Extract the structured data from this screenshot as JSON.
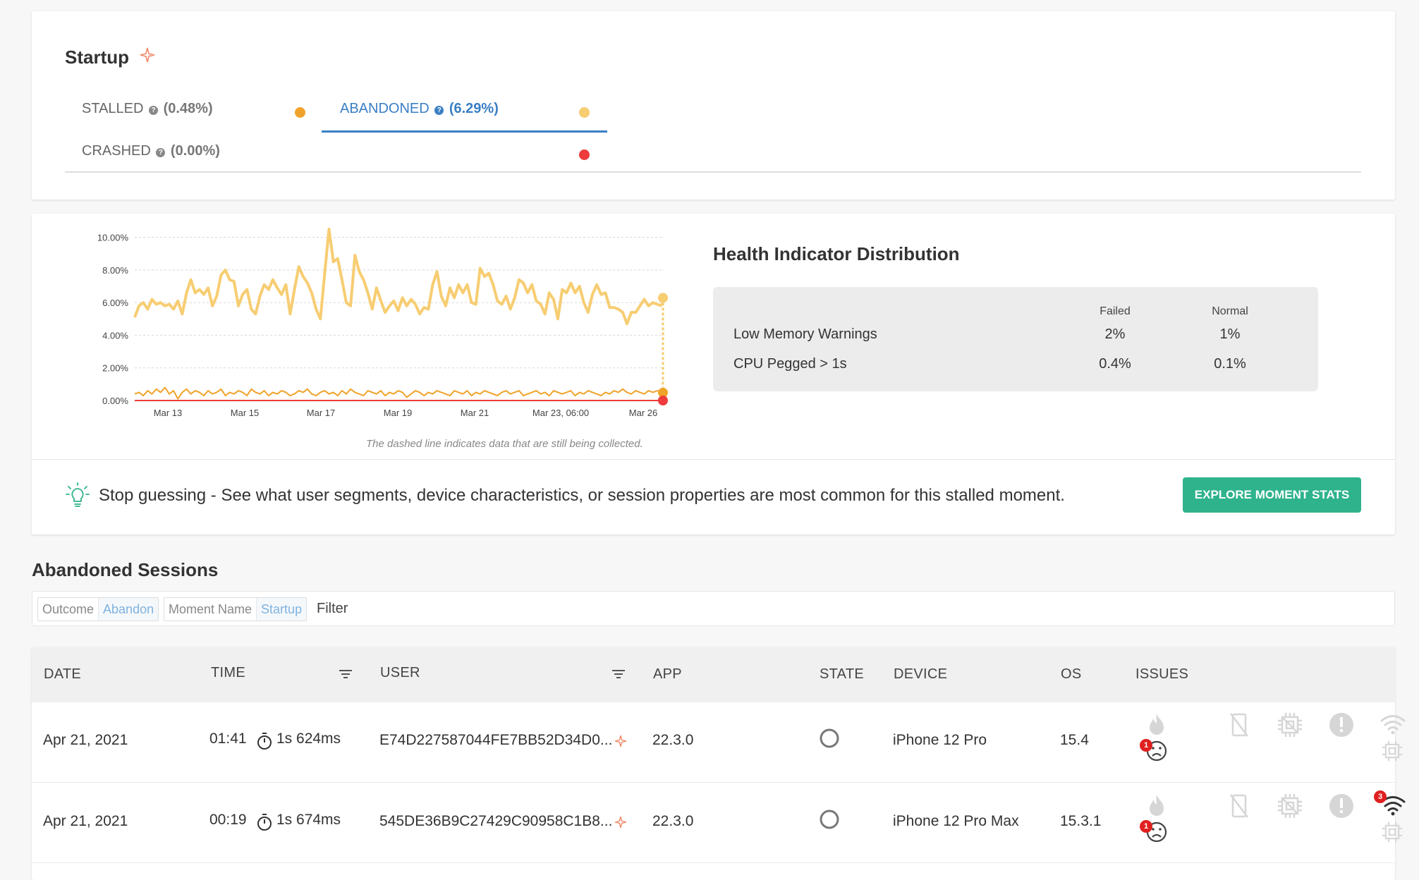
{
  "startup": {
    "title": "Startup",
    "tabs": [
      {
        "label": "STALLED",
        "pct": "(0.48%)",
        "color": "#f0a32a"
      },
      {
        "label": "ABANDONED",
        "pct": "(6.29%)",
        "color": "#f7cd72"
      },
      {
        "label": "CRASHED",
        "pct": "(0.00%)",
        "color": "#ee3b3b"
      }
    ],
    "active_tab": "ABANDONED"
  },
  "chart_data": {
    "type": "line",
    "y_ticks": [
      "10.00%",
      "8.00%",
      "6.00%",
      "4.00%",
      "2.00%",
      "0.00%"
    ],
    "ylim": [
      0,
      10.5
    ],
    "x_ticks": [
      "Mar 13",
      "Mar 15",
      "Mar 17",
      "Mar 19",
      "Mar 21",
      "Mar 23, 06:00",
      "Mar 26"
    ],
    "grid": true,
    "series": [
      {
        "color": "#f7cd72",
        "values": [
          5.1,
          5.8,
          6.0,
          5.6,
          6.2,
          5.9,
          6.0,
          5.8,
          5.9,
          5.6,
          6.1,
          5.3,
          6.6,
          7.4,
          6.6,
          6.8,
          6.5,
          6.9,
          5.8,
          6.4,
          7.7,
          8.0,
          7.4,
          7.3,
          5.8,
          6.5,
          6.8,
          5.6,
          5.3,
          6.4,
          7.1,
          6.8,
          7.4,
          6.9,
          6.5,
          7.1,
          5.3,
          6.8,
          8.2,
          7.6,
          7.2,
          6.6,
          5.6,
          5.0,
          7.8,
          10.5,
          8.5,
          8.7,
          7.4,
          6.0,
          5.8,
          8.9,
          7.9,
          7.4,
          6.6,
          5.6,
          6.9,
          6.1,
          5.4,
          5.8,
          6.1,
          5.5,
          6.3,
          5.8,
          6.2,
          5.9,
          5.3,
          5.7,
          5.6,
          7.1,
          7.9,
          6.4,
          5.8,
          6.9,
          6.3,
          7.1,
          6.6,
          7.1,
          6.0,
          5.9,
          8.1,
          7.6,
          7.8,
          7.1,
          6.1,
          5.9,
          6.4,
          5.6,
          6.3,
          7.4,
          7.2,
          6.6,
          7.1,
          6.1,
          5.9,
          5.3,
          6.6,
          6.2,
          5.0,
          6.8,
          6.6,
          7.2,
          6.6,
          7.0,
          6.0,
          5.4,
          6.5,
          7.1,
          6.5,
          6.6,
          5.7,
          5.7,
          5.6,
          5.4,
          4.7,
          5.4,
          5.4,
          5.8,
          6.2,
          5.8,
          6.0,
          5.9,
          5.8
        ]
      },
      {
        "color": "#f0a32a",
        "values": [
          0.4,
          0.5,
          0.3,
          0.6,
          0.4,
          0.7,
          0.5,
          0.8,
          0.4,
          0.6,
          0.1,
          0.5,
          0.7,
          0.4,
          0.6,
          0.5,
          0.3,
          0.6,
          0.4,
          0.5,
          0.7,
          0.3,
          0.5,
          0.4,
          0.6,
          0.5,
          0.3,
          0.7,
          0.5,
          0.4,
          0.6,
          0.3,
          0.5,
          0.4,
          0.6,
          0.5,
          0.3,
          0.4,
          0.6,
          0.5,
          0.7,
          0.4,
          0.3,
          0.5,
          0.6,
          0.4,
          0.5,
          0.3,
          0.6,
          0.4,
          0.7,
          0.5,
          0.4,
          0.3,
          0.6,
          0.5,
          0.4,
          0.6,
          0.3,
          0.5,
          0.4,
          0.6,
          0.5,
          0.2,
          0.4,
          0.6,
          0.5,
          0.3,
          0.5,
          0.4,
          0.6,
          0.5,
          0.4,
          0.3,
          0.6,
          0.5,
          0.4,
          0.6,
          0.3,
          0.5,
          0.4,
          0.6,
          0.5,
          0.4,
          0.3,
          0.5,
          0.6,
          0.4,
          0.5,
          0.6,
          0.3,
          0.4,
          0.5,
          0.6,
          0.4,
          0.5,
          0.3,
          0.6,
          0.5,
          0.4,
          0.5,
          0.6,
          0.3,
          0.5,
          0.4,
          0.6,
          0.5,
          0.4,
          0.3,
          0.5,
          0.4,
          0.6,
          0.5,
          0.7,
          0.5,
          0.4,
          0.6,
          0.5,
          0.4,
          0.6,
          0.5,
          0.6,
          0.5
        ]
      },
      {
        "color": "#ee3b3b",
        "values": [
          0.0,
          0.0,
          0.0,
          0.0,
          0.0,
          0.0,
          0.0,
          0.0,
          0.0,
          0.0,
          0.0,
          0.0,
          0.0,
          0.0,
          0.0,
          0.0,
          0.0,
          0.0,
          0.0,
          0.0,
          0.0,
          0.0,
          0.0,
          0.0,
          0.0,
          0.0,
          0.0,
          0.0,
          0.0,
          0.0,
          0.0,
          0.0,
          0.0,
          0.0,
          0.0,
          0.0,
          0.0,
          0.0,
          0.0,
          0.0,
          0.0,
          0.0,
          0.0,
          0.0,
          0.0,
          0.0,
          0.0,
          0.0,
          0.0,
          0.0,
          0.0,
          0.0,
          0.0,
          0.0,
          0.0,
          0.0,
          0.0,
          0.0,
          0.0,
          0.0,
          0.0,
          0.0,
          0.0,
          0.0,
          0.0,
          0.0,
          0.0,
          0.0,
          0.0,
          0.0,
          0.0,
          0.0,
          0.0,
          0.0,
          0.0,
          0.0,
          0.0,
          0.0,
          0.0,
          0.0,
          0.0,
          0.0,
          0.0,
          0.0,
          0.0,
          0.0,
          0.0,
          0.0,
          0.0,
          0.0,
          0.0,
          0.0,
          0.0,
          0.0,
          0.0,
          0.0,
          0.0,
          0.0,
          0.0,
          0.0,
          0.0,
          0.0,
          0.0,
          0.0,
          0.0,
          0.0,
          0.0,
          0.0,
          0.0,
          0.0,
          0.0,
          0.0,
          0.0,
          0.0,
          0.0,
          0.0,
          0.0,
          0.0,
          0.0,
          0.0,
          0.0,
          0.0,
          0.0
        ]
      }
    ],
    "end_values": [
      6.29,
      0.48,
      0.0
    ],
    "dashed_note": "The dashed line indicates data that are still being collected."
  },
  "health": {
    "title": "Health Indicator Distribution",
    "col_failed": "Failed",
    "col_normal": "Normal",
    "rows": [
      {
        "label": "Low Memory Warnings",
        "failed": "2%",
        "normal": "1%"
      },
      {
        "label": "CPU Pegged > 1s",
        "failed": "0.4%",
        "normal": "0.1%"
      }
    ]
  },
  "tip": {
    "text": "Stop guessing - See what user segments, device characteristics, or session properties are most common for this stalled moment.",
    "button": "EXPLORE MOMENT STATS"
  },
  "sessions": {
    "title": "Abandoned Sessions",
    "filters": [
      {
        "key": "Outcome",
        "value": "Abandon"
      },
      {
        "key": "Moment Name",
        "value": "Startup"
      }
    ],
    "filter_placeholder": "Filter",
    "columns": [
      "DATE",
      "TIME",
      "USER",
      "APP",
      "STATE",
      "DEVICE",
      "OS",
      "ISSUES"
    ],
    "rows": [
      {
        "date": "Apr 21, 2021",
        "time": "01:41",
        "duration": "1s 624ms",
        "user": "E74D227587044FE7BB52D34D0...",
        "app": "22.3.0",
        "device": "iPhone 12 Pro",
        "os": "15.4",
        "crash_badge": "1",
        "network_badge": ""
      },
      {
        "date": "Apr 21, 2021",
        "time": "00:19",
        "duration": "1s 674ms",
        "user": "545DE36B9C27429C90958C1B8...",
        "app": "22.3.0",
        "device": "iPhone 12 Pro Max",
        "os": "15.3.1",
        "crash_badge": "1",
        "network_badge": "3"
      }
    ]
  }
}
